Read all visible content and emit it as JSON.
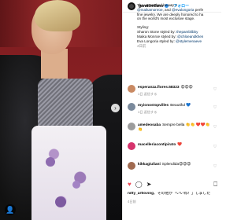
{
  "header": {
    "username": "garattimilano",
    "separator": "•",
    "follow_label": "フォロー"
  },
  "caption": {
    "line1": "The unmatched beauty o",
    "mention1": "@maikamonroe",
    "line2_mid": ", and",
    "mention2": "@evalongoria",
    "line2_end": "perfe",
    "line3": "fine jewelry. We are deeply honored to ha",
    "line4": "on the world's most exclusive stage.",
    "styling_title": "Styling:",
    "styling1_prefix": "Sharon Stone styled by:",
    "styling1_link": "thepamblibby",
    "styling2_prefix": "Maika Monroe styled by:",
    "styling2_link": "@chloeandkhen",
    "styling3_prefix": "Eva Longoria styled by:",
    "styling3_link": "@stylemenaeve",
    "time": "4日前"
  },
  "comments": [
    {
      "user": "esperanza.flores.58323",
      "text": "😍😍😍",
      "meta": "1日  返信する",
      "avatar_color": "#c98a63"
    },
    {
      "user": "myionostopvilles",
      "text": "Beautiful 💙",
      "meta": "1日  返信する",
      "avatar_color": "#7a8a9c"
    },
    {
      "user": "amedeosaba",
      "text": "Sempre bella 👏👏 ❤️❤️👏👏",
      "meta": "",
      "avatar_color": "#9c9c9c"
    },
    {
      "user": "macelleriacontipirato",
      "text": "❤️",
      "meta": "",
      "avatar_color": "#d6336c"
    },
    {
      "user": "kikkagiuliani",
      "text": "Splendida😍😍😍",
      "meta": "",
      "avatar_color": "#a06a50"
    }
  ],
  "likes": {
    "user": "nitty_artloving",
    "text": "、その他が「いいね！」しました"
  },
  "post_date": "4日前",
  "photo": {
    "tag_icon": "user-tag-icon",
    "nav_icon": "chevron-right-icon"
  },
  "colors": {
    "link": "#00376b",
    "follow": "#0095f6",
    "verified": "#3897f0"
  }
}
